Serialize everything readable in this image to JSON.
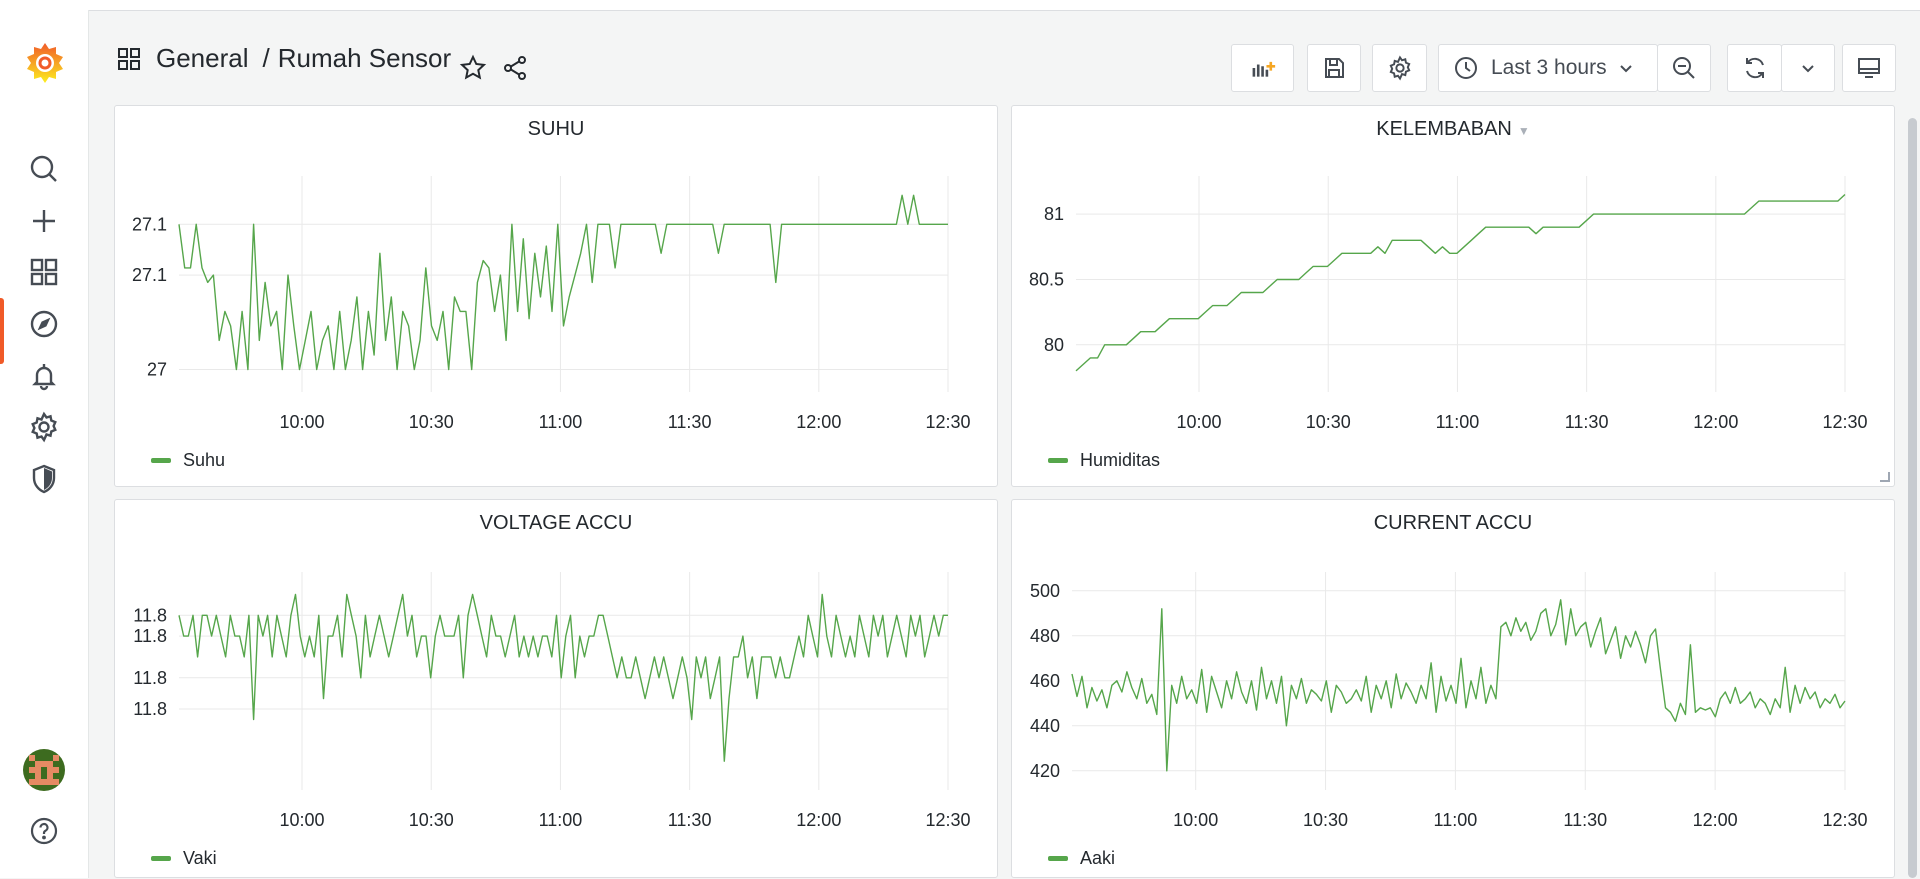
{
  "breadcrumb": {
    "folder": "General",
    "separator": "/",
    "dashboard": "Rumah Sensor"
  },
  "toolbar": {
    "time_range": "Last 3 hours"
  },
  "panels": [
    {
      "title": "SUHU",
      "legend": "Suhu",
      "show_menu_caret": false
    },
    {
      "title": "KELEMBABAN",
      "legend": "Humiditas",
      "show_menu_caret": true
    },
    {
      "title": "VOLTAGE ACCU",
      "legend": "Vaki",
      "show_menu_caret": false
    },
    {
      "title": "CURRENT ACCU",
      "legend": "Aaki",
      "show_menu_caret": false
    }
  ],
  "colors": {
    "series": "#56a64b",
    "accent": "#f05a28",
    "grid": "#e9e9e9"
  },
  "chart_data": [
    {
      "type": "line",
      "title": "SUHU",
      "x_tick_labels": [
        "10:00",
        "10:30",
        "11:00",
        "11:30",
        "12:00",
        "12:30"
      ],
      "y_tick_labels": [
        "27.1",
        "27.1",
        "27"
      ],
      "series": [
        {
          "name": "Suhu",
          "x_range": [
            "09:45",
            "12:30"
          ],
          "values": [
            27.1,
            27.07,
            27.07,
            27.1,
            27.07,
            27.06,
            27.065,
            27.02,
            27.04,
            27.03,
            27.0,
            27.04,
            27.0,
            27.1,
            27.02,
            27.06,
            27.03,
            27.04,
            27.0,
            27.065,
            27.03,
            27.0,
            27.02,
            27.04,
            27.0,
            27.02,
            27.03,
            27.0,
            27.04,
            27.0,
            27.02,
            27.05,
            27.0,
            27.04,
            27.01,
            27.08,
            27.02,
            27.05,
            27.0,
            27.04,
            27.03,
            27.0,
            27.02,
            27.07,
            27.03,
            27.02,
            27.04,
            27.0,
            27.05,
            27.04,
            27.04,
            27.0,
            27.06,
            27.075,
            27.07,
            27.04,
            27.065,
            27.02,
            27.1,
            27.04,
            27.09,
            27.035,
            27.08,
            27.05,
            27.085,
            27.04,
            27.1,
            27.03,
            27.05,
            27.065,
            27.08,
            27.1,
            27.06,
            27.1,
            27.1,
            27.1,
            27.07,
            27.1,
            27.1,
            27.1,
            27.1,
            27.1,
            27.1,
            27.1,
            27.08,
            27.1,
            27.1,
            27.1,
            27.1,
            27.1,
            27.1,
            27.1,
            27.1,
            27.1,
            27.08,
            27.1,
            27.1,
            27.1,
            27.1,
            27.1,
            27.1,
            27.1,
            27.1,
            27.1,
            27.06,
            27.1,
            27.1,
            27.1,
            27.1,
            27.1,
            27.1,
            27.1,
            27.1,
            27.1,
            27.1,
            27.1,
            27.1,
            27.1,
            27.1,
            27.1,
            27.1,
            27.1,
            27.1,
            27.1,
            27.1,
            27.1,
            27.12,
            27.1,
            27.12,
            27.1,
            27.1,
            27.1,
            27.1,
            27.1,
            27.1
          ]
        }
      ],
      "ylim": [
        26.99,
        27.125
      ]
    },
    {
      "type": "line",
      "title": "KELEMBABAN",
      "x_tick_labels": [
        "10:00",
        "10:30",
        "11:00",
        "11:30",
        "12:00",
        "12:30"
      ],
      "y_tick_labels": [
        "81",
        "80.5",
        "80"
      ],
      "series": [
        {
          "name": "Humiditas",
          "x_range": [
            "09:45",
            "12:30"
          ],
          "values": [
            79.8,
            79.85,
            79.9,
            79.9,
            80.0,
            80.0,
            80.0,
            80.0,
            80.05,
            80.1,
            80.1,
            80.1,
            80.15,
            80.2,
            80.2,
            80.2,
            80.2,
            80.2,
            80.25,
            80.3,
            80.3,
            80.3,
            80.35,
            80.4,
            80.4,
            80.4,
            80.4,
            80.45,
            80.5,
            80.5,
            80.5,
            80.5,
            80.55,
            80.6,
            80.6,
            80.6,
            80.65,
            80.7,
            80.7,
            80.7,
            80.7,
            80.7,
            80.75,
            80.7,
            80.8,
            80.8,
            80.8,
            80.8,
            80.8,
            80.75,
            80.7,
            80.75,
            80.7,
            80.7,
            80.75,
            80.8,
            80.85,
            80.9,
            80.9,
            80.9,
            80.9,
            80.9,
            80.9,
            80.9,
            80.85,
            80.9,
            80.9,
            80.9,
            80.9,
            80.9,
            80.9,
            80.95,
            81.0,
            81.0,
            81.0,
            81.0,
            81.0,
            81.0,
            81.0,
            81.0,
            81.0,
            81.0,
            81.0,
            81.0,
            81.0,
            81.0,
            81.0,
            81.0,
            81.0,
            81.0,
            81.0,
            81.0,
            81.0,
            81.0,
            81.05,
            81.1,
            81.1,
            81.1,
            81.1,
            81.1,
            81.1,
            81.1,
            81.1,
            81.1,
            81.1,
            81.1,
            81.1,
            81.15
          ]
        }
      ],
      "ylim": [
        79.7,
        81.2
      ]
    },
    {
      "type": "line",
      "title": "VOLTAGE ACCU",
      "x_tick_labels": [
        "10:00",
        "10:30",
        "11:00",
        "11:30",
        "12:00",
        "12:30"
      ],
      "y_tick_labels": [
        "11.8",
        "11.8",
        "11.8",
        "11.8"
      ],
      "series": [
        {
          "name": "Vaki",
          "values": [
            11.83,
            11.82,
            11.82,
            11.83,
            11.81,
            11.83,
            11.83,
            11.82,
            11.83,
            11.82,
            11.81,
            11.83,
            11.82,
            11.82,
            11.81,
            11.83,
            11.78,
            11.83,
            11.82,
            11.83,
            11.81,
            11.83,
            11.82,
            11.81,
            11.83,
            11.84,
            11.82,
            11.81,
            11.82,
            11.81,
            11.83,
            11.79,
            11.82,
            11.82,
            11.83,
            11.81,
            11.84,
            11.83,
            11.82,
            11.8,
            11.83,
            11.81,
            11.82,
            11.83,
            11.82,
            11.81,
            11.82,
            11.83,
            11.84,
            11.82,
            11.83,
            11.81,
            11.82,
            11.82,
            11.8,
            11.82,
            11.83,
            11.82,
            11.82,
            11.82,
            11.83,
            11.8,
            11.83,
            11.84,
            11.83,
            11.82,
            11.81,
            11.83,
            11.82,
            11.82,
            11.81,
            11.82,
            11.83,
            11.81,
            11.82,
            11.81,
            11.82,
            11.81,
            11.82,
            11.82,
            11.81,
            11.83,
            11.8,
            11.82,
            11.83,
            11.8,
            11.82,
            11.81,
            11.82,
            11.82,
            11.83,
            11.83,
            11.82,
            11.81,
            11.8,
            11.81,
            11.8,
            11.8,
            11.81,
            11.8,
            11.79,
            11.8,
            11.81,
            11.8,
            11.81,
            11.8,
            11.79,
            11.8,
            11.81,
            11.8,
            11.78,
            11.81,
            11.8,
            11.81,
            11.79,
            11.8,
            11.81,
            11.76,
            11.79,
            11.81,
            11.81,
            11.82,
            11.8,
            11.81,
            11.79,
            11.81,
            11.81,
            11.81,
            11.8,
            11.81,
            11.8,
            11.8,
            11.81,
            11.82,
            11.81,
            11.83,
            11.82,
            11.81,
            11.84,
            11.82,
            11.81,
            11.83,
            11.82,
            11.81,
            11.82,
            11.81,
            11.83,
            11.82,
            11.81,
            11.83,
            11.82,
            11.83,
            11.81,
            11.82,
            11.83,
            11.82,
            11.81,
            11.83,
            11.82,
            11.83,
            11.81,
            11.82,
            11.83,
            11.82,
            11.83,
            11.83
          ]
        }
      ],
      "ylim": [
        11.75,
        11.845
      ]
    },
    {
      "type": "line",
      "title": "CURRENT ACCU",
      "x_tick_labels": [
        "10:00",
        "10:30",
        "11:00",
        "11:30",
        "12:00",
        "12:30"
      ],
      "y_tick_labels": [
        "500",
        "480",
        "460",
        "440",
        "420"
      ],
      "series": [
        {
          "name": "Aaki",
          "values": [
            463,
            453,
            462,
            448,
            457,
            451,
            456,
            448,
            458,
            460,
            455,
            464,
            457,
            452,
            461,
            450,
            454,
            445,
            492,
            420,
            458,
            450,
            462,
            452,
            456,
            450,
            465,
            446,
            462,
            455,
            448,
            460,
            452,
            464,
            455,
            450,
            460,
            447,
            466,
            452,
            460,
            450,
            462,
            440,
            458,
            452,
            461,
            450,
            456,
            454,
            451,
            460,
            446,
            458,
            455,
            450,
            452,
            456,
            451,
            462,
            446,
            458,
            452,
            460,
            448,
            463,
            452,
            459,
            455,
            450,
            458,
            452,
            468,
            446,
            462,
            451,
            458,
            450,
            470,
            448,
            460,
            452,
            466,
            450,
            458,
            452,
            484,
            486,
            480,
            488,
            482,
            486,
            478,
            482,
            490,
            492,
            480,
            485,
            496,
            476,
            492,
            480,
            484,
            486,
            475,
            482,
            488,
            472,
            478,
            484,
            470,
            480,
            475,
            482,
            476,
            468,
            480,
            483,
            465,
            448,
            446,
            442,
            450,
            445,
            476,
            446,
            448,
            447,
            448,
            444,
            452,
            455,
            450,
            457,
            450,
            452,
            455,
            448,
            452,
            450,
            445,
            452,
            448,
            466,
            446,
            458,
            450,
            457,
            452,
            455,
            448,
            452,
            450,
            454,
            448,
            451
          ]
        }
      ],
      "ylim": [
        415,
        503
      ]
    }
  ]
}
